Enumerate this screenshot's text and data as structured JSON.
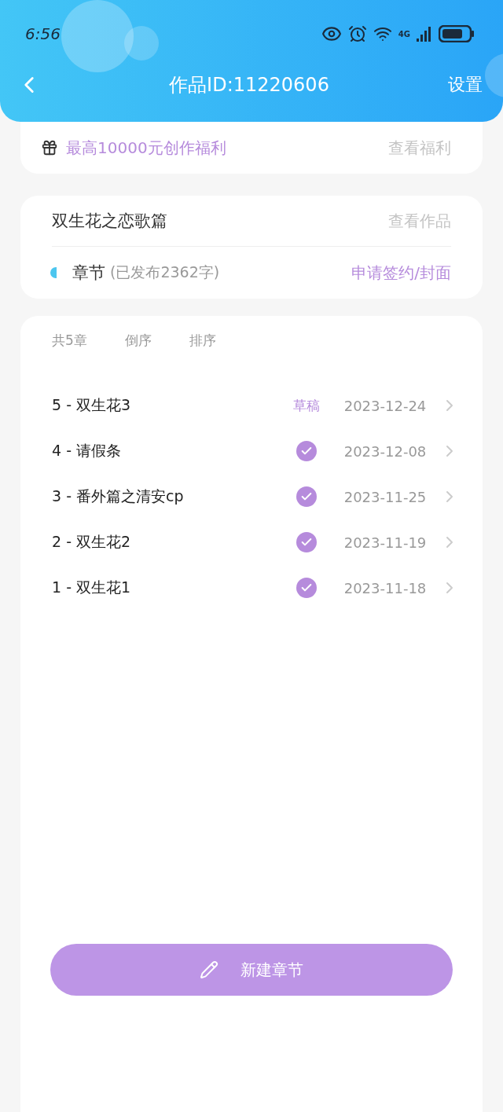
{
  "status_bar": {
    "time": "6:56",
    "network": "4G"
  },
  "nav": {
    "title": "作品ID:11220606",
    "action": "设置"
  },
  "benefit": {
    "text": "最高10000元创作福利",
    "link": "查看福利"
  },
  "work": {
    "title": "双生花之恋歌篇",
    "link": "查看作品",
    "section": "章节",
    "stats": "(已发布2362字)",
    "action": "申请签约/封面"
  },
  "list_header": [
    {
      "label": "共5章"
    },
    {
      "label": "倒序"
    },
    {
      "label": "排序"
    }
  ],
  "chapters": [
    {
      "title": "5 - 双生花3",
      "kind": "draft",
      "status": "草稿",
      "date": "2023-12-24"
    },
    {
      "title": "4 - 请假条",
      "kind": "published",
      "date": "2023-12-08"
    },
    {
      "title": "3 - 番外篇之清安cp",
      "kind": "published",
      "date": "2023-11-25"
    },
    {
      "title": "2 - 双生花2",
      "kind": "published",
      "date": "2023-11-19"
    },
    {
      "title": "1 - 双生花1",
      "kind": "published",
      "date": "2023-11-18"
    }
  ],
  "new_button": "新建章节"
}
